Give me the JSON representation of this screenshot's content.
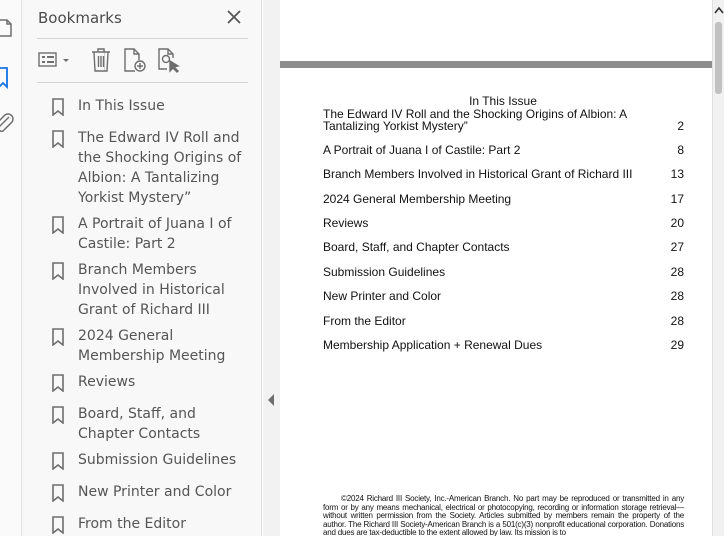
{
  "panel": {
    "title": "Bookmarks",
    "toolbar": {
      "options_icon": "bookmark-options-icon",
      "delete_icon": "trash-icon",
      "new_bookmark_icon": "new-bookmark-icon",
      "find_icon": "find-bookmark-icon"
    },
    "bookmarks": [
      {
        "label": "In This Issue"
      },
      {
        "label": "The Edward IV Roll and the Shocking Origins of Albion: A Tantalizing Yorkist Mystery”"
      },
      {
        "label": "A Portrait of Juana I of Castile: Part 2"
      },
      {
        "label": "Branch Members Involved in Historical Grant of Richard III"
      },
      {
        "label": "2024 General Membership Meeting"
      },
      {
        "label": "Reviews"
      },
      {
        "label": "Board, Staff, and Chapter Contacts"
      },
      {
        "label": "Submission Guidelines"
      },
      {
        "label": "New Printer and Color"
      },
      {
        "label": "From the Editor"
      }
    ]
  },
  "document": {
    "toc_heading": "In This Issue",
    "toc": [
      {
        "title": "The Edward IV Roll and the Shocking Origins of Albion: A Tantalizing Yorkist Mystery”",
        "page": "2"
      },
      {
        "title": "A Portrait of Juana I of Castile: Part 2",
        "page": "8"
      },
      {
        "title": "Branch Members Involved in Historical Grant of Richard III",
        "page": "13"
      },
      {
        "title": "2024 General Membership Meeting",
        "page": "17"
      },
      {
        "title": "Reviews",
        "page": "20"
      },
      {
        "title": "Board, Staff, and Chapter Contacts",
        "page": "27"
      },
      {
        "title": "Submission Guidelines",
        "page": "28"
      },
      {
        "title": "New Printer and Color",
        "page": "28"
      },
      {
        "title": "From the Editor",
        "page": "28"
      },
      {
        "title": "Membership Application + Renewal Dues",
        "page": "29"
      }
    ],
    "copyright": "©2024 Richard III Society, Inc.-American Branch. No part may be reproduced or transmitted in any form or by any means mechanical, electrical or photocopying, recording or information storage retrieval—without written permission from the Society. Articles submitted by members remain the property of the author. The Richard III Society-American Branch is a 501(c)(3) nonprofit educational corporation. Donations and dues are tax-deductible to the extent allowed by law. Its mission is to"
  },
  "colors": {
    "accent": "#1473e6",
    "panel_bg": "#f8f8f8",
    "page_gap": "#8c8c8c",
    "icon_gray": "#6e6e6e"
  },
  "icons": {
    "strip": [
      "pages-icon",
      "bookmarks-icon",
      "attachments-icon"
    ],
    "close": "close-icon",
    "collapse": "collapse-panel-icon",
    "scroll_up": "scroll-up-icon"
  }
}
